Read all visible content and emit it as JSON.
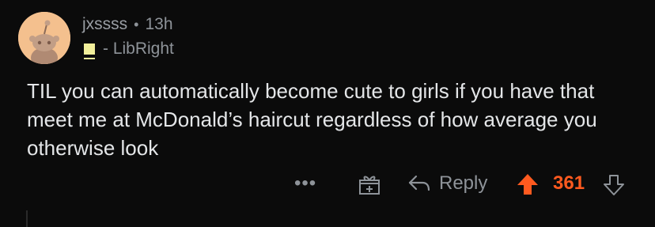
{
  "comment": {
    "username": "jxssss",
    "separator": "•",
    "age": "13h",
    "flair_text": "- LibRight",
    "body": "TIL you can automatically become cute to girls if you have that meet me at McDonald’s haircut regardless of how average you otherwise look"
  },
  "actions": {
    "more_label": "•••",
    "reply_label": "Reply",
    "score": "361"
  },
  "colors": {
    "background": "#0b0b0b",
    "upvote_active": "#ff5a1f",
    "flair": "#f2ef9a",
    "avatar_bg": "#f4c08e"
  },
  "icons": {
    "avatar": "snoo-avatar-icon",
    "gift": "gift-icon",
    "reply": "reply-arrow-icon",
    "upvote": "upvote-arrow-icon",
    "downvote": "downvote-arrow-icon",
    "more": "more-options-icon"
  }
}
